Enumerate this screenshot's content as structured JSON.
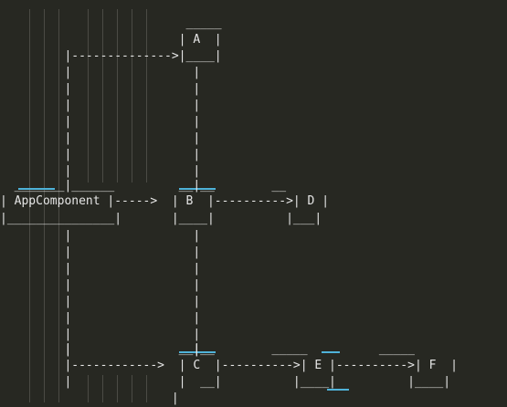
{
  "colors": {
    "background": "#272822",
    "text": "#e6e6e6",
    "indent_guide": "#4b4b45",
    "accent": "#4fb3d9"
  },
  "lines": [
    "                          _____",
    "                         | A  |",
    "         |-------------->|____|",
    "         |                 |",
    "         |                 |",
    "         |                 |",
    "         |                 |",
    "         |                 |",
    "         |                 |",
    "         |                 |",
    "  _______|______         __|__        __",
    "| AppComponent |----->  | B  |---------->| D |",
    "|_______________|       |____|          |___|",
    "         |                 |",
    "         |                 |",
    "         |                 |",
    "         |                 |",
    "         |                 |",
    "         |                 |",
    "         |                 |",
    "         |                 |",
    "         |               __|__        _____          _____",
    "         |------------>  | C  |---------->| E |---------->| F  |",
    "         |               |  __|          |____|          |____|",
    "                        |"
  ]
}
